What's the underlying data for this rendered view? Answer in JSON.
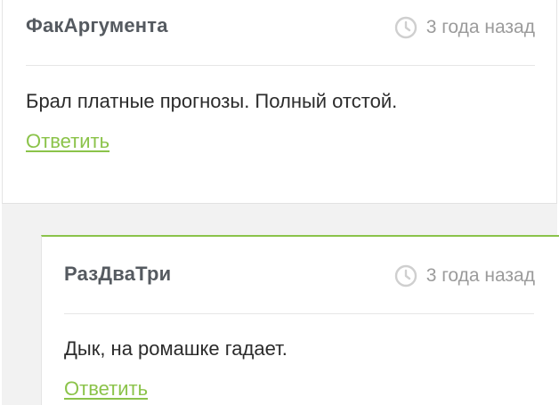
{
  "comments": [
    {
      "author": "ФакАргумента",
      "time": "3 года назад",
      "text": "Брал платные прогнозы. Полный отстой.",
      "reply_label": "Ответить"
    },
    {
      "author": "РазДваТри",
      "time": "3 года назад",
      "text": "Дык, на ромашке гадает.",
      "reply_label": "Ответить"
    }
  ],
  "icons": {
    "time": "clock-icon"
  },
  "colors": {
    "accent": "#8bc34a",
    "author": "#555a60",
    "meta": "#9b9b9b",
    "text": "#2b2b2b",
    "thread_bg": "#f2f2f2"
  }
}
